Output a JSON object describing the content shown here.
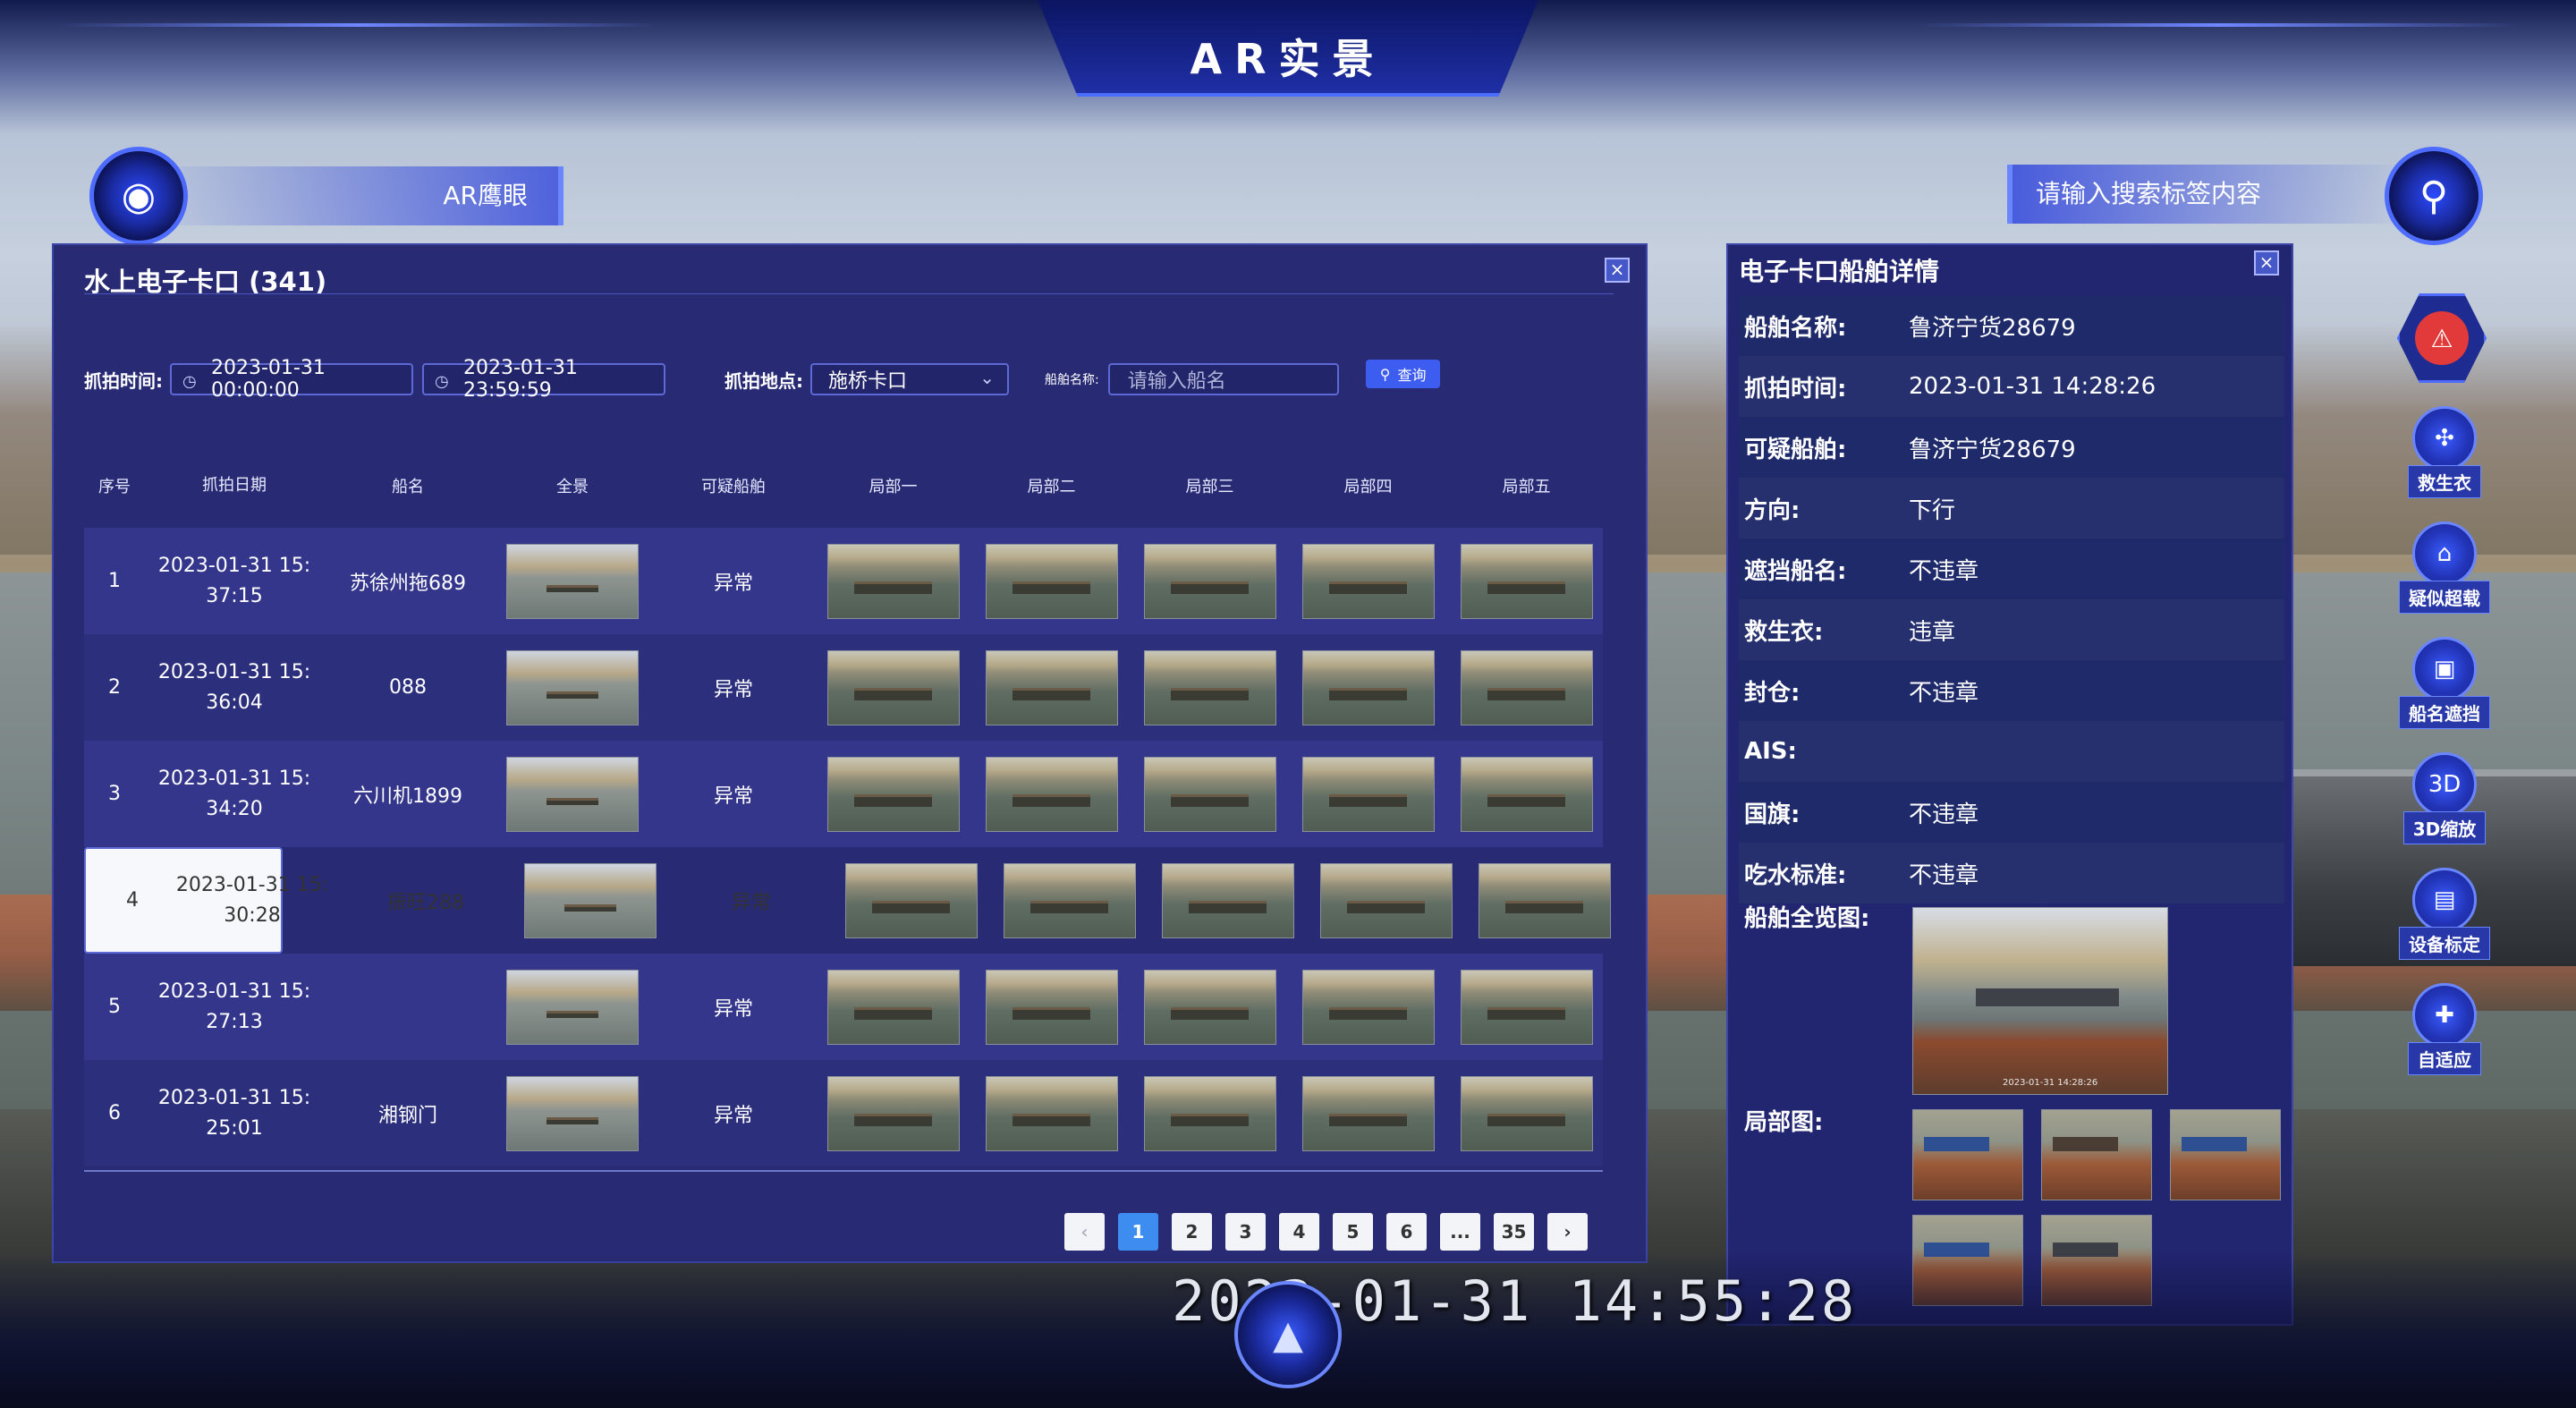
{
  "app": {
    "title": "AR实景"
  },
  "header": {
    "ar_eye_label": "AR鹰眼",
    "search_placeholder": "请输入搜索标签内容"
  },
  "main_panel": {
    "title": "水上电子卡口 (341)",
    "filters": {
      "time_label": "抓拍时间:",
      "start_time": "2023-01-31 00:00:00",
      "end_time": "2023-01-31 23:59:59",
      "location_label": "抓拍地点:",
      "location_value": "施桥卡口",
      "ship_name_label": "船舶名称:",
      "ship_name_placeholder": "请输入船名",
      "query_label": "查询"
    },
    "columns": [
      "序号",
      "抓拍日期",
      "船名",
      "全景",
      "可疑船舶",
      "局部一",
      "局部二",
      "局部三",
      "局部四",
      "局部五"
    ],
    "rows": [
      {
        "no": "1",
        "date_l1": "2023-01-31 15:",
        "date_l2": "37:15",
        "name": "苏徐州拖689",
        "suspicious": "异常"
      },
      {
        "no": "2",
        "date_l1": "2023-01-31 15:",
        "date_l2": "36:04",
        "name": "088",
        "suspicious": "异常"
      },
      {
        "no": "3",
        "date_l1": "2023-01-31 15:",
        "date_l2": "34:20",
        "name": "六川机1899",
        "suspicious": "异常"
      },
      {
        "no": "4",
        "date_l1": "2023-01-31 15:",
        "date_l2": "30:28",
        "name": "振旺288",
        "suspicious": "异常"
      },
      {
        "no": "5",
        "date_l1": "2023-01-31 15:",
        "date_l2": "27:13",
        "name": "",
        "suspicious": "异常"
      },
      {
        "no": "6",
        "date_l1": "2023-01-31 15:",
        "date_l2": "25:01",
        "name": "湘钢门",
        "suspicious": "异常"
      }
    ],
    "pagination": {
      "prev": "‹",
      "pages": [
        "1",
        "2",
        "3",
        "4",
        "5",
        "6",
        "...",
        "35"
      ],
      "next": "›",
      "current": "1"
    }
  },
  "detail_panel": {
    "title": "电子卡口船舶详情",
    "fields": [
      {
        "label": "船舶名称:",
        "value": "鲁济宁货28679"
      },
      {
        "label": "抓拍时间:",
        "value": "2023-01-31 14:28:26"
      },
      {
        "label": "可疑船舶:",
        "value": "鲁济宁货28679"
      },
      {
        "label": "方向:",
        "value": "下行"
      },
      {
        "label": "遮挡船名:",
        "value": "不违章"
      },
      {
        "label": "救生衣:",
        "value": "违章"
      },
      {
        "label": "封仓:",
        "value": "不违章"
      },
      {
        "label": "AIS:",
        "value": ""
      },
      {
        "label": "国旗:",
        "value": "不违章"
      },
      {
        "label": "吃水标准:",
        "value": "不违章"
      }
    ],
    "full_view_label": "船舶全览图:",
    "full_view_stamp": "2023-01-31 14:28:26",
    "local_label": "局部图:"
  },
  "side_tools": [
    {
      "label": "救生衣",
      "icon": "life-vest-icon",
      "glyph": "✣"
    },
    {
      "label": "疑似超载",
      "icon": "overload-icon",
      "glyph": "⌂"
    },
    {
      "label": "船名遮挡",
      "icon": "camera-icon",
      "glyph": "▣"
    },
    {
      "label": "3D缩放",
      "icon": "3d-icon",
      "glyph": "3D"
    },
    {
      "label": "设备标定",
      "icon": "device-icon",
      "glyph": "▤"
    },
    {
      "label": "自适应",
      "icon": "adapt-icon",
      "glyph": "✚"
    }
  ],
  "clock": "2023-01-31 14:55:28"
}
